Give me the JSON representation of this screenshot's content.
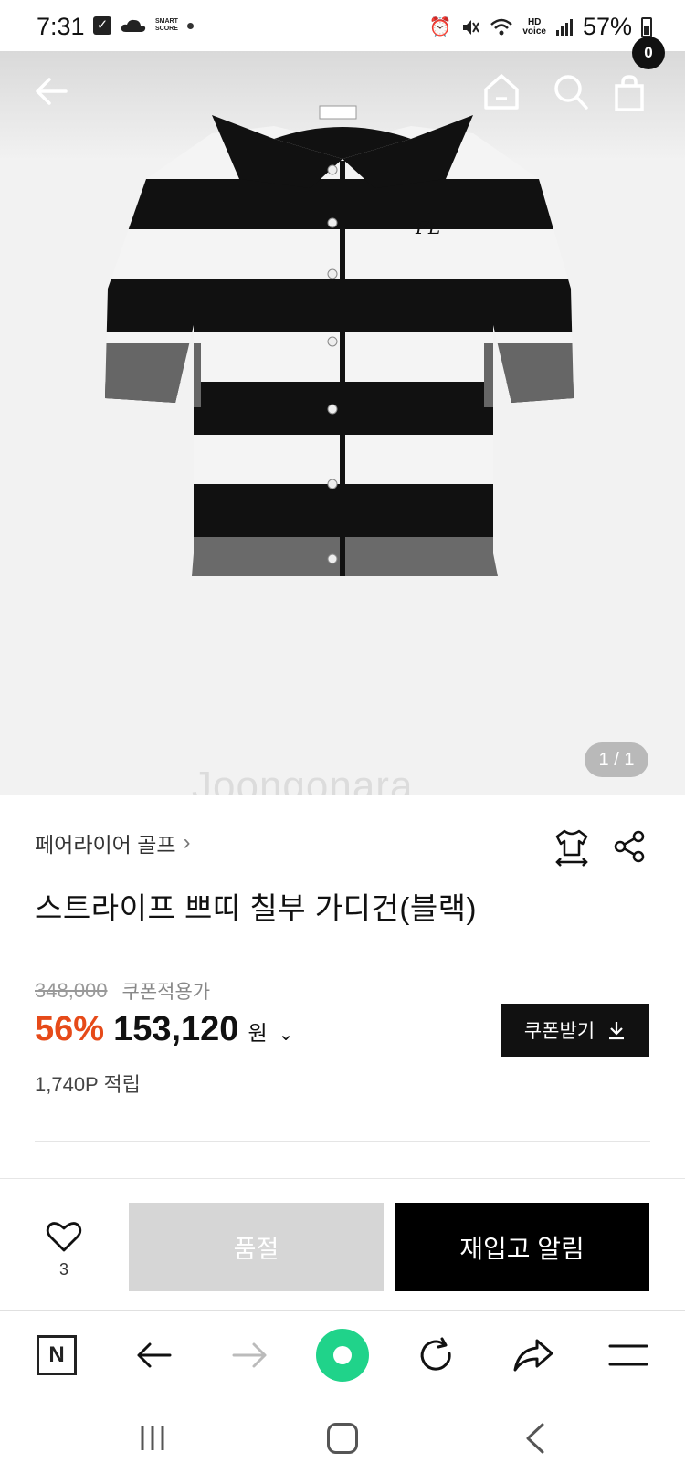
{
  "status_bar": {
    "time": "7:31",
    "smart_score_label": "SMART\nSCORE",
    "battery": "57%",
    "hd_voice": "HD\nvoice"
  },
  "top_nav": {
    "back_icon": "arrow-left-icon",
    "home_icon": "home-icon",
    "search_icon": "search-icon",
    "bag_icon": "shopping-bag-icon",
    "bag_count": "0"
  },
  "gallery": {
    "counter": "1 / 1",
    "watermark": "Joongonara"
  },
  "product": {
    "brand": "페어라이어 골프",
    "title": "스트라이프 쁘띠 칠부 가디건(블랙)",
    "original_price": "348,000",
    "coupon_applied_label": "쿠폰적용가",
    "discount": "56%",
    "price": "153,120",
    "currency": "원",
    "coupon_button": "쿠폰받기",
    "points": "1,740P 적립"
  },
  "purchase_bar": {
    "like_count": "3",
    "soldout_label": "품절",
    "restock_label": "재입고 알림"
  },
  "browser_bar": {
    "n_label": "N"
  },
  "colors": {
    "discount": "#e64a19",
    "primary_button": "#000000",
    "disabled_button": "#d6d6d6",
    "green_button": "#20d38a"
  }
}
